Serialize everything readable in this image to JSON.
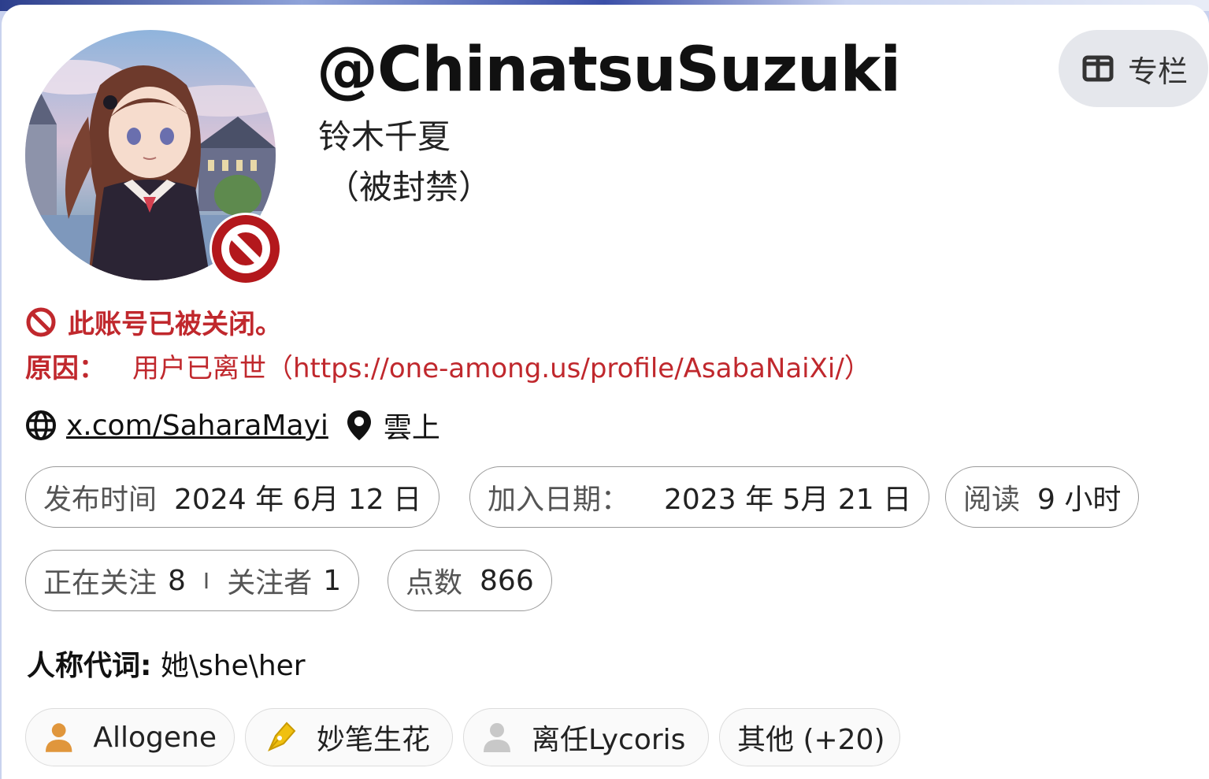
{
  "profile": {
    "handle": "@ChinatsuSuzuki",
    "display_name": "铃木千夏",
    "banned_note": "（被封禁）",
    "avatar_alt": "avatar"
  },
  "header": {
    "column_button_label": "专栏"
  },
  "status": {
    "closed_message": "此账号已被关闭。",
    "reason_label": "原因：",
    "reason_text": "用户已离世（https://one-among.us/profile/AsabaNaiXi/）",
    "accent_color": "#c0282d"
  },
  "links": {
    "website": "x.com/SaharaMayi",
    "location": "雲上"
  },
  "stats": {
    "published_label": "发布时间",
    "published_value": "2024 年 6月 12 日",
    "joined_label": "加入日期：",
    "joined_value": "2023 年 5月 21 日",
    "reading_label": "阅读",
    "reading_value": "9 小时",
    "following_label": "正在关注",
    "following_value": "8",
    "separator": "I",
    "followers_label": "关注者",
    "followers_value": "1",
    "points_label": "点数",
    "points_value": "866"
  },
  "pronouns": {
    "label": "人称代词:",
    "value": "她\\she\\her"
  },
  "tags": [
    {
      "label": "Allogene",
      "icon": "person-icon",
      "color": "#e0963c"
    },
    {
      "label": "妙笔生花",
      "icon": "pen-nib-icon",
      "color": "#f0c010"
    },
    {
      "label": "离任Lycoris",
      "icon": "person-icon",
      "color": "#c8c8c8"
    },
    {
      "label": "其他 (+20)"
    }
  ]
}
